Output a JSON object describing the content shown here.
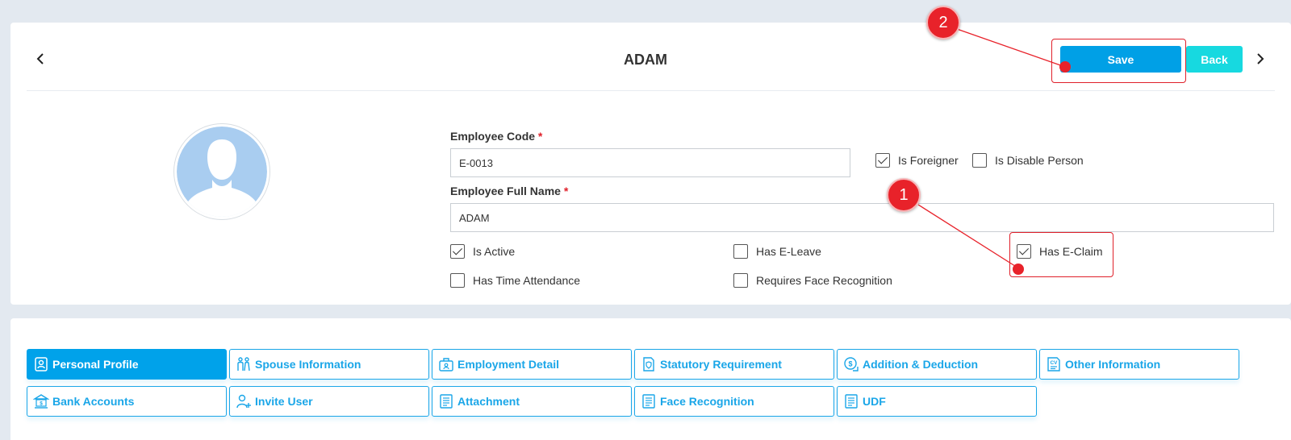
{
  "header": {
    "title": "ADAM",
    "save_label": "Save",
    "back_label": "Back"
  },
  "form": {
    "employee_code_label": "Employee Code",
    "employee_code_value": "E-0013",
    "employee_name_label": "Employee Full Name",
    "employee_name_value": "ADAM",
    "required_mark": "*",
    "checkboxes": {
      "is_foreigner": {
        "label": "Is Foreigner",
        "checked": true
      },
      "is_disable_person": {
        "label": "Is Disable Person",
        "checked": false
      },
      "is_active": {
        "label": "Is Active",
        "checked": true
      },
      "has_e_leave": {
        "label": "Has E-Leave",
        "checked": false
      },
      "has_e_claim": {
        "label": "Has E-Claim",
        "checked": true
      },
      "has_time_attendance": {
        "label": "Has Time Attendance",
        "checked": false
      },
      "requires_face_recognition": {
        "label": "Requires Face Recognition",
        "checked": false
      }
    }
  },
  "annotations": {
    "step1": "1",
    "step2": "2"
  },
  "tabs": [
    {
      "label": "Personal Profile",
      "icon": "profile-icon",
      "active": true
    },
    {
      "label": "Spouse Information",
      "icon": "couple-icon",
      "active": false
    },
    {
      "label": "Employment Detail",
      "icon": "briefcase-icon",
      "active": false
    },
    {
      "label": "Statutory Requirement",
      "icon": "shield-document-icon",
      "active": false
    },
    {
      "label": "Addition & Deduction",
      "icon": "coin-icon",
      "active": false
    },
    {
      "label": "Other Information",
      "icon": "cv-icon",
      "active": false
    },
    {
      "label": "Bank Accounts",
      "icon": "bank-icon",
      "active": false
    },
    {
      "label": "Invite User",
      "icon": "add-user-icon",
      "active": false
    },
    {
      "label": "Attachment",
      "icon": "document-icon",
      "active": false
    },
    {
      "label": "Face Recognition",
      "icon": "document-icon",
      "active": false
    },
    {
      "label": "UDF",
      "icon": "document-icon",
      "active": false
    }
  ],
  "colors": {
    "primary": "#00a2ea",
    "accent": "#17d9e0",
    "annotation": "#e8222a",
    "required": "#e0202a"
  }
}
